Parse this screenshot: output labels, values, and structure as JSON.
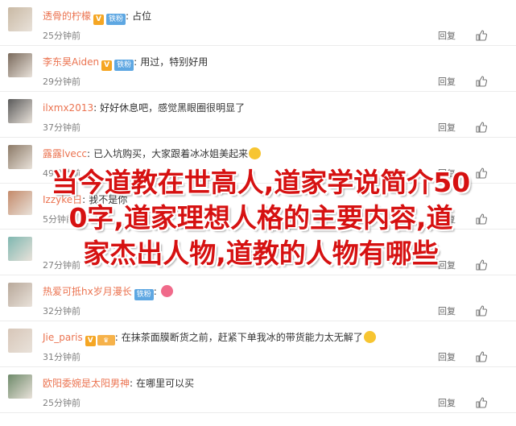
{
  "comments": [
    {
      "user": "透骨的柠檬",
      "verified": true,
      "fan_badge": "铁粉",
      "crown": false,
      "text": "占位",
      "time": "25分钟前",
      "avatar_color": "#c9b9a4"
    },
    {
      "user": "李东昊Aiden",
      "verified": true,
      "fan_badge": "铁粉",
      "crown": false,
      "text": "用过，特别好用",
      "time": "29分钟前",
      "avatar_color": "#7a6a5c"
    },
    {
      "user": "ilxmx2013",
      "verified": false,
      "fan_badge": "",
      "crown": false,
      "text": "好好休息吧，感觉黑眼圈很明显了",
      "time": "37分钟前",
      "avatar_color": "#5a5a5a"
    },
    {
      "user": "露露lvecc",
      "verified": false,
      "fan_badge": "",
      "crown": false,
      "text": "已入坑购买，大家跟着冰冰姐美起来",
      "time": "49分钟前",
      "avatar_color": "#8c7a67"
    },
    {
      "user": "Izzyke日",
      "verified": false,
      "fan_badge": "",
      "crown": false,
      "text": "我不是你",
      "time": "5分钟前",
      "avatar_color": "#c48a6a"
    },
    {
      "user": "",
      "verified": false,
      "fan_badge": "",
      "crown": false,
      "text": "",
      "time": "27分钟前",
      "avatar_color": "#7fb7b0"
    },
    {
      "user": "热爱可抵hx岁月漫长",
      "verified": false,
      "fan_badge": "铁粉",
      "crown": false,
      "text": "",
      "time": "32分钟前",
      "avatar_color": "#b8a89a"
    },
    {
      "user": "Jie_paris",
      "verified": true,
      "fan_badge": "",
      "crown": true,
      "text": "在抹茶面膜断货之前，赶紧下单我冰的带货能力太无解了",
      "time": "31分钟前",
      "avatar_color": "#d7c6b8"
    },
    {
      "user": "欧阳委婉是太阳男神",
      "verified": false,
      "fan_badge": "",
      "crown": false,
      "text": "在哪里可以买",
      "time": "25分钟前",
      "avatar_color": "#6e8a6a"
    }
  ],
  "labels": {
    "reply": "回复",
    "colon": ":",
    "verified_mark": "V",
    "crown_mark": "♛"
  },
  "overlay": {
    "line1": "当今道教在世高人,道家学说简介50",
    "line2": "0字,道家理想人格的主要内容,道",
    "line3": "家杰出人物,道教的人物有哪些"
  }
}
